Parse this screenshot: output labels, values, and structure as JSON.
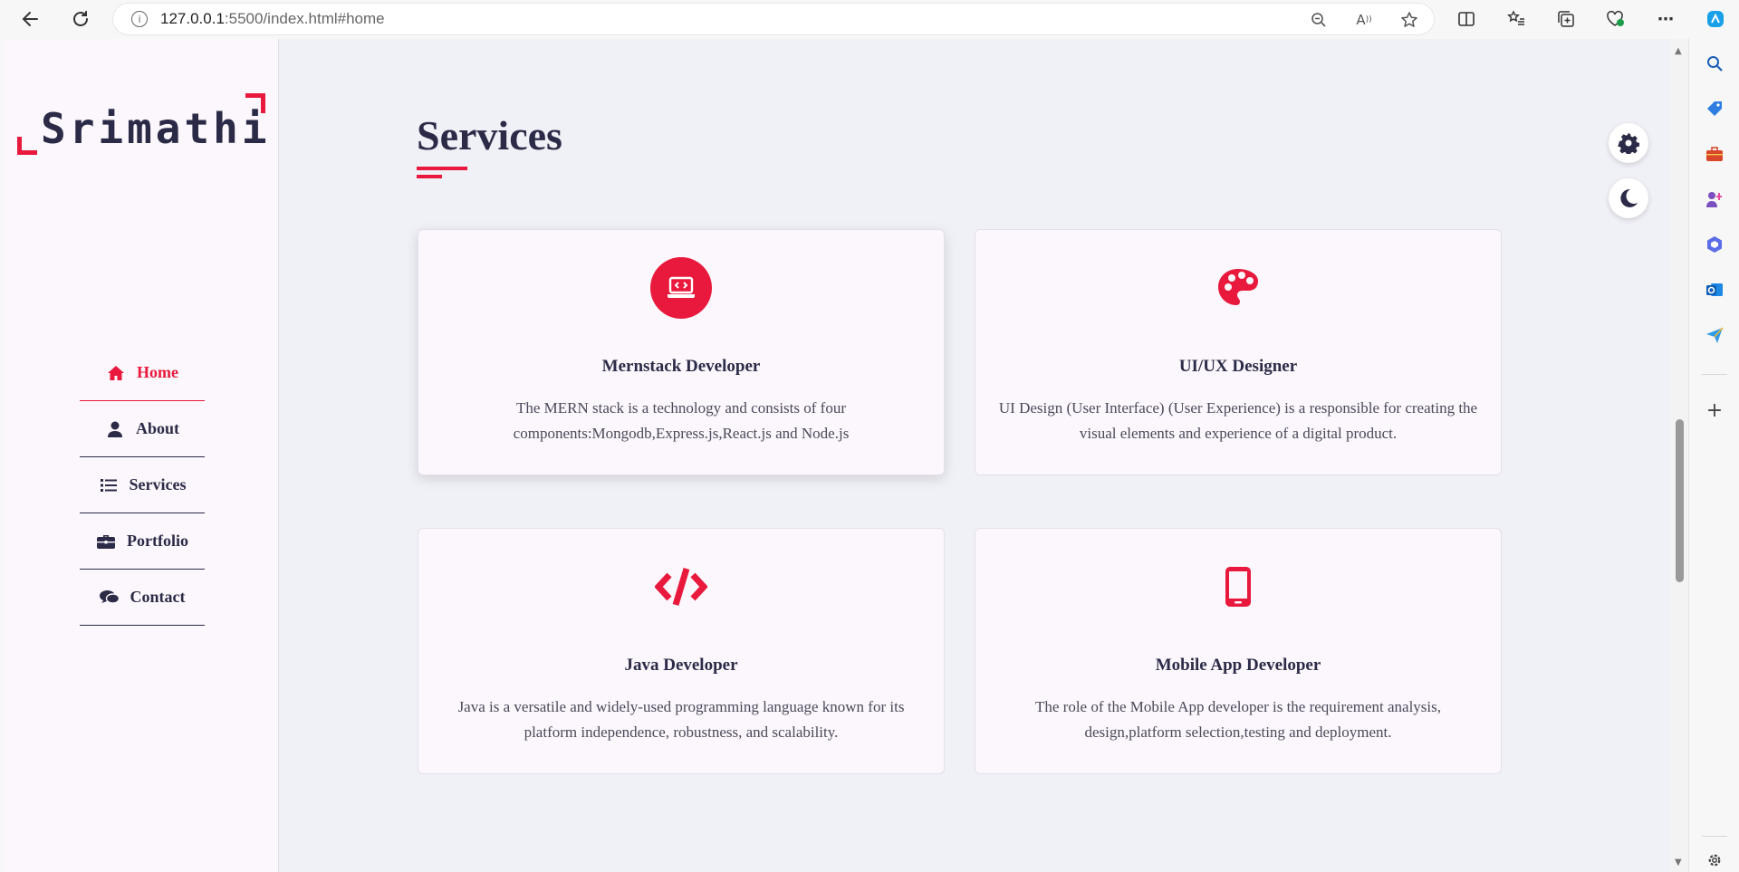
{
  "browser": {
    "url_host": "127.0.0.1",
    "url_rest": ":5500/index.html#home"
  },
  "site": {
    "logo": "Srimathi",
    "nav": [
      {
        "label": "Home",
        "icon": "home-icon",
        "active": true
      },
      {
        "label": "About",
        "icon": "user-icon",
        "active": false
      },
      {
        "label": "Services",
        "icon": "list-icon",
        "active": false
      },
      {
        "label": "Portfolio",
        "icon": "briefcase-icon",
        "active": false
      },
      {
        "label": "Contact",
        "icon": "comments-icon",
        "active": false
      }
    ],
    "section_title": "Services",
    "services": [
      {
        "title": "Mernstack Developer",
        "desc": "The MERN stack is a technology and consists of four components:Mongodb,Express.js,React.js and Node.js",
        "icon": "laptop-code-icon"
      },
      {
        "title": "UI/UX Designer",
        "desc": "UI Design (User Interface) (User Experience) is a responsible for creating the visual elements and experience of a digital product.",
        "icon": "palette-icon"
      },
      {
        "title": "Java Developer",
        "desc": "Java is a versatile and widely-used programming language known for its platform independence, robustness, and scalability.",
        "icon": "code-icon"
      },
      {
        "title": "Mobile App Developer",
        "desc": "The role of the Mobile App developer is the requirement analysis, design,platform selection,testing and deployment.",
        "icon": "mobile-icon"
      }
    ]
  },
  "colors": {
    "accent": "#e8193c",
    "dark": "#2b2b48",
    "sidebar_bg": "#fcf7fc",
    "main_bg": "#f0f0f7"
  }
}
